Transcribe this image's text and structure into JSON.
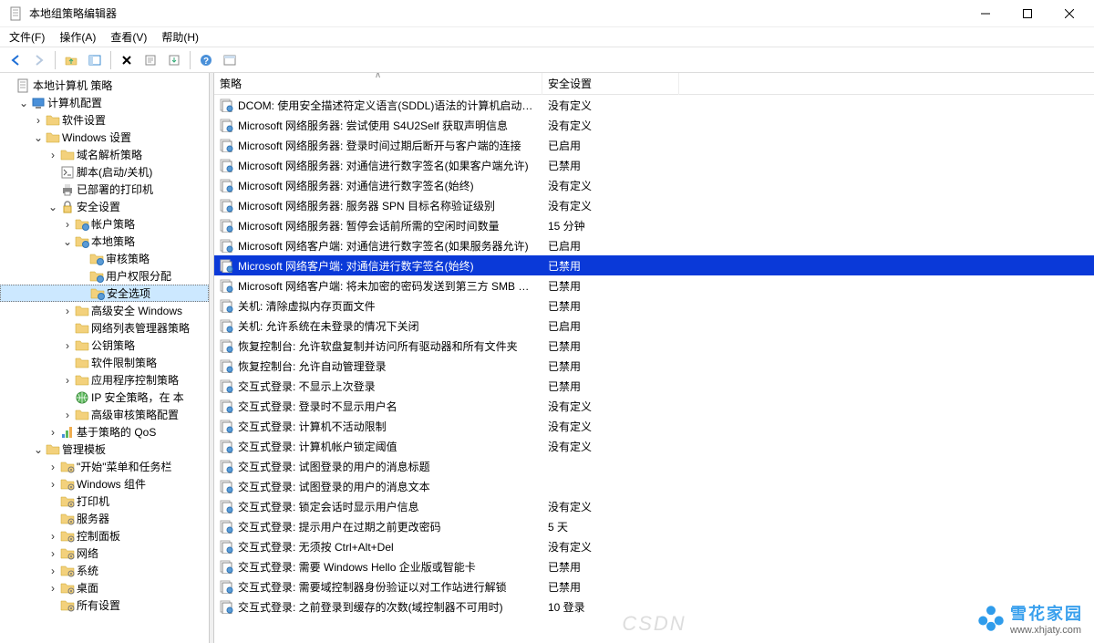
{
  "window": {
    "title": "本地组策略编辑器"
  },
  "menu": [
    "文件(F)",
    "操作(A)",
    "查看(V)",
    "帮助(H)"
  ],
  "columns": {
    "policy": "策略",
    "setting": "安全设置"
  },
  "tree": [
    {
      "depth": 0,
      "label": "本地计算机 策略",
      "icon": "doc",
      "exp": ""
    },
    {
      "depth": 1,
      "label": "计算机配置",
      "icon": "computer",
      "exp": "open"
    },
    {
      "depth": 2,
      "label": "软件设置",
      "icon": "folder",
      "exp": "closed"
    },
    {
      "depth": 2,
      "label": "Windows 设置",
      "icon": "folder",
      "exp": "open"
    },
    {
      "depth": 3,
      "label": "域名解析策略",
      "icon": "folder",
      "exp": "closed"
    },
    {
      "depth": 3,
      "label": "脚本(启动/关机)",
      "icon": "script",
      "exp": ""
    },
    {
      "depth": 3,
      "label": "已部署的打印机",
      "icon": "printer",
      "exp": ""
    },
    {
      "depth": 3,
      "label": "安全设置",
      "icon": "security",
      "exp": "open"
    },
    {
      "depth": 4,
      "label": "帐户策略",
      "icon": "folder-badge",
      "exp": "closed"
    },
    {
      "depth": 4,
      "label": "本地策略",
      "icon": "folder-badge",
      "exp": "open"
    },
    {
      "depth": 5,
      "label": "审核策略",
      "icon": "folder-badge",
      "exp": ""
    },
    {
      "depth": 5,
      "label": "用户权限分配",
      "icon": "folder-badge",
      "exp": ""
    },
    {
      "depth": 5,
      "label": "安全选项",
      "icon": "folder-badge",
      "exp": "",
      "selected": true
    },
    {
      "depth": 4,
      "label": "高级安全 Windows",
      "icon": "folder",
      "exp": "closed"
    },
    {
      "depth": 4,
      "label": "网络列表管理器策略",
      "icon": "folder",
      "exp": ""
    },
    {
      "depth": 4,
      "label": "公钥策略",
      "icon": "folder",
      "exp": "closed"
    },
    {
      "depth": 4,
      "label": "软件限制策略",
      "icon": "folder",
      "exp": ""
    },
    {
      "depth": 4,
      "label": "应用程序控制策略",
      "icon": "folder",
      "exp": "closed"
    },
    {
      "depth": 4,
      "label": "IP 安全策略，在 本",
      "icon": "ipsec",
      "exp": ""
    },
    {
      "depth": 4,
      "label": "高级审核策略配置",
      "icon": "folder",
      "exp": "closed"
    },
    {
      "depth": 3,
      "label": "基于策略的 QoS",
      "icon": "qos",
      "exp": "closed"
    },
    {
      "depth": 2,
      "label": "管理模板",
      "icon": "folder",
      "exp": "open"
    },
    {
      "depth": 3,
      "label": "\"开始\"菜单和任务栏",
      "icon": "folder-cfg",
      "exp": "closed"
    },
    {
      "depth": 3,
      "label": "Windows 组件",
      "icon": "folder-cfg",
      "exp": "closed"
    },
    {
      "depth": 3,
      "label": "打印机",
      "icon": "folder-cfg",
      "exp": ""
    },
    {
      "depth": 3,
      "label": "服务器",
      "icon": "folder-cfg",
      "exp": ""
    },
    {
      "depth": 3,
      "label": "控制面板",
      "icon": "folder-cfg",
      "exp": "closed"
    },
    {
      "depth": 3,
      "label": "网络",
      "icon": "folder-cfg",
      "exp": "closed"
    },
    {
      "depth": 3,
      "label": "系统",
      "icon": "folder-cfg",
      "exp": "closed"
    },
    {
      "depth": 3,
      "label": "桌面",
      "icon": "folder-cfg",
      "exp": "closed"
    },
    {
      "depth": 3,
      "label": "所有设置",
      "icon": "folder-cfg",
      "exp": ""
    }
  ],
  "rows": [
    {
      "name": "DCOM: 使用安全描述符定义语言(SDDL)语法的计算机启动…",
      "value": "没有定义"
    },
    {
      "name": "Microsoft 网络服务器: 尝试使用 S4U2Self 获取声明信息",
      "value": "没有定义"
    },
    {
      "name": "Microsoft 网络服务器: 登录时间过期后断开与客户端的连接",
      "value": "已启用"
    },
    {
      "name": "Microsoft 网络服务器: 对通信进行数字签名(如果客户端允许)",
      "value": "已禁用"
    },
    {
      "name": "Microsoft 网络服务器: 对通信进行数字签名(始终)",
      "value": "没有定义"
    },
    {
      "name": "Microsoft 网络服务器: 服务器 SPN 目标名称验证级别",
      "value": "没有定义"
    },
    {
      "name": "Microsoft 网络服务器: 暂停会话前所需的空闲时间数量",
      "value": "15 分钟"
    },
    {
      "name": "Microsoft 网络客户端: 对通信进行数字签名(如果服务器允许)",
      "value": "已启用"
    },
    {
      "name": "Microsoft 网络客户端: 对通信进行数字签名(始终)",
      "value": "已禁用",
      "selected": true
    },
    {
      "name": "Microsoft 网络客户端: 将未加密的密码发送到第三方 SMB …",
      "value": "已禁用"
    },
    {
      "name": "关机: 清除虚拟内存页面文件",
      "value": "已禁用"
    },
    {
      "name": "关机: 允许系统在未登录的情况下关闭",
      "value": "已启用"
    },
    {
      "name": "恢复控制台: 允许软盘复制并访问所有驱动器和所有文件夹",
      "value": "已禁用"
    },
    {
      "name": "恢复控制台: 允许自动管理登录",
      "value": "已禁用"
    },
    {
      "name": "交互式登录: 不显示上次登录",
      "value": "已禁用"
    },
    {
      "name": "交互式登录: 登录时不显示用户名",
      "value": "没有定义"
    },
    {
      "name": "交互式登录: 计算机不活动限制",
      "value": "没有定义"
    },
    {
      "name": "交互式登录: 计算机帐户锁定阈值",
      "value": "没有定义"
    },
    {
      "name": "交互式登录: 试图登录的用户的消息标题",
      "value": ""
    },
    {
      "name": "交互式登录: 试图登录的用户的消息文本",
      "value": ""
    },
    {
      "name": "交互式登录: 锁定会话时显示用户信息",
      "value": "没有定义"
    },
    {
      "name": "交互式登录: 提示用户在过期之前更改密码",
      "value": "5 天"
    },
    {
      "name": "交互式登录: 无须按 Ctrl+Alt+Del",
      "value": "没有定义"
    },
    {
      "name": "交互式登录: 需要 Windows Hello 企业版或智能卡",
      "value": "已禁用"
    },
    {
      "name": "交互式登录: 需要域控制器身份验证以对工作站进行解锁",
      "value": "已禁用"
    },
    {
      "name": "交互式登录: 之前登录到缓存的次数(域控制器不可用时)",
      "value": "10 登录"
    }
  ],
  "watermark": {
    "line1": "雪花家园",
    "line2": "www.xhjaty.com"
  }
}
